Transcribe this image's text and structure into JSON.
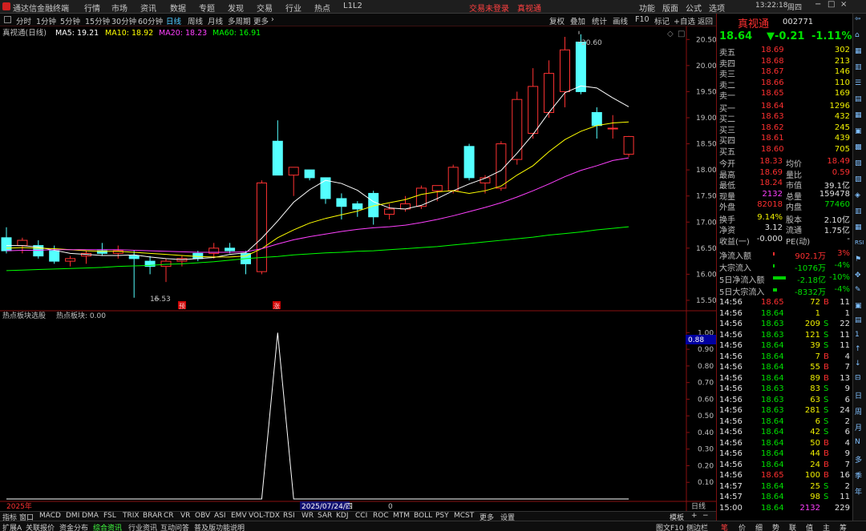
{
  "menubar": {
    "app_title": "通达信金融终端",
    "menus": [
      "行情",
      "市场",
      "资讯",
      "数据",
      "专题",
      "发现",
      "交易",
      "行业",
      "热点",
      "L1L2"
    ],
    "login_status": "交易未登录",
    "stock_name_top": "真视通",
    "right_menus": [
      "功能",
      "版面",
      "公式",
      "选项"
    ],
    "clock": "13:22:18",
    "weekday": "周四"
  },
  "periodbar": {
    "periods": [
      "分时",
      "1分钟",
      "5分钟",
      "15分钟",
      "30分钟",
      "60分钟",
      "日线",
      "周线",
      "月线",
      "多周期",
      "更多"
    ],
    "selected": "日线",
    "tools": [
      "复权",
      "叠加",
      "统计",
      "画线",
      "F10",
      "标记",
      "+自选",
      "返回"
    ]
  },
  "chart": {
    "title": "真视通(日线)",
    "ma_labels": [
      {
        "text": "MA5: 19.21",
        "color": "#ffffff"
      },
      {
        "text": "MA10: 18.92",
        "color": "#ffff00"
      },
      {
        "text": "MA20: 18.23",
        "color": "#ff40ff"
      },
      {
        "text": "MA60: 16.91",
        "color": "#00ff00"
      }
    ],
    "high_label": "20.60",
    "low_label": "15.53",
    "yu_marker": "预",
    "zhang_marker": "涨",
    "price_ticks": [
      "20.50",
      "20.00",
      "19.50",
      "19.00",
      "18.50",
      "18.00",
      "17.50",
      "17.00",
      "16.50",
      "16.00",
      "15.50"
    ],
    "indicator_title": "热点板块选股",
    "indicator_value": "热点板块: 0.00",
    "ind_ticks": [
      "1.00",
      "0.90",
      "0.80",
      "0.70",
      "0.60",
      "0.50",
      "0.40",
      "0.30",
      "0.20",
      "0.10"
    ],
    "ind_current": "0.88",
    "year_label": "2025年",
    "cursor_date": "2025/07/24/四",
    "cursor_val": "0",
    "period_tag": "日线"
  },
  "chart_data": {
    "type": "candlestick",
    "ylim": [
      15.3,
      20.75
    ],
    "candles": [
      {
        "o": 16.7,
        "h": 16.9,
        "l": 16.4,
        "c": 16.45
      },
      {
        "o": 16.55,
        "h": 16.7,
        "l": 16.4,
        "c": 16.65
      },
      {
        "o": 16.55,
        "h": 16.65,
        "l": 16.3,
        "c": 16.35
      },
      {
        "o": 16.45,
        "h": 16.55,
        "l": 16.2,
        "c": 16.25
      },
      {
        "o": 16.25,
        "h": 16.35,
        "l": 16.15,
        "c": 16.3
      },
      {
        "o": 16.35,
        "h": 16.45,
        "l": 16.2,
        "c": 16.4
      },
      {
        "o": 16.45,
        "h": 16.6,
        "l": 16.35,
        "c": 16.4
      },
      {
        "o": 16.4,
        "h": 16.55,
        "l": 16.3,
        "c": 16.45
      },
      {
        "o": 16.35,
        "h": 16.45,
        "l": 15.55,
        "c": 16.3
      },
      {
        "o": 16.25,
        "h": 16.35,
        "l": 16.0,
        "c": 16.15
      },
      {
        "o": 16.15,
        "h": 16.3,
        "l": 15.85,
        "c": 16.25
      },
      {
        "o": 16.25,
        "h": 16.35,
        "l": 16.15,
        "c": 16.3
      },
      {
        "o": 16.4,
        "h": 16.45,
        "l": 16.25,
        "c": 16.3
      },
      {
        "o": 16.4,
        "h": 16.6,
        "l": 16.3,
        "c": 16.5
      },
      {
        "o": 16.5,
        "h": 16.6,
        "l": 16.4,
        "c": 16.45
      },
      {
        "o": 16.4,
        "h": 16.45,
        "l": 16.0,
        "c": 16.2
      },
      {
        "o": 16.05,
        "h": 17.8,
        "l": 16.0,
        "c": 17.75
      },
      {
        "o": 18.55,
        "h": 18.95,
        "l": 17.9,
        "c": 17.9
      },
      {
        "o": 17.9,
        "h": 18.0,
        "l": 17.5,
        "c": 18.05
      },
      {
        "o": 18.0,
        "h": 18.0,
        "l": 17.8,
        "c": 17.85
      },
      {
        "o": 17.85,
        "h": 17.85,
        "l": 17.35,
        "c": 17.45
      },
      {
        "o": 17.45,
        "h": 17.55,
        "l": 17.05,
        "c": 17.3
      },
      {
        "o": 17.35,
        "h": 17.4,
        "l": 17.1,
        "c": 17.25
      },
      {
        "o": 17.55,
        "h": 17.6,
        "l": 16.95,
        "c": 17.1
      },
      {
        "o": 17.15,
        "h": 17.35,
        "l": 17.05,
        "c": 17.25
      },
      {
        "o": 17.25,
        "h": 17.5,
        "l": 17.2,
        "c": 17.35
      },
      {
        "o": 17.3,
        "h": 17.7,
        "l": 17.25,
        "c": 17.65
      },
      {
        "o": 17.6,
        "h": 17.7,
        "l": 17.4,
        "c": 17.7
      },
      {
        "o": 17.6,
        "h": 18.1,
        "l": 17.55,
        "c": 18.05
      },
      {
        "o": 18.45,
        "h": 18.5,
        "l": 17.8,
        "c": 17.85
      },
      {
        "o": 17.75,
        "h": 17.9,
        "l": 17.55,
        "c": 17.85
      },
      {
        "o": 17.65,
        "h": 18.55,
        "l": 17.6,
        "c": 18.5
      },
      {
        "o": 18.2,
        "h": 19.5,
        "l": 18.1,
        "c": 19.35
      },
      {
        "o": 18.7,
        "h": 19.95,
        "l": 18.6,
        "c": 19.6
      },
      {
        "o": 19.1,
        "h": 20.1,
        "l": 19.0,
        "c": 19.85
      },
      {
        "o": 19.5,
        "h": 20.55,
        "l": 19.2,
        "c": 20.3
      },
      {
        "o": 20.45,
        "h": 20.6,
        "l": 19.45,
        "c": 19.5
      },
      {
        "o": 19.1,
        "h": 19.2,
        "l": 18.6,
        "c": 18.85
      },
      {
        "o": 18.8,
        "h": 19.05,
        "l": 18.6,
        "c": 18.8
      },
      {
        "o": 18.3,
        "h": 18.65,
        "l": 18.25,
        "c": 18.64
      }
    ],
    "ma5": [
      16.55,
      16.55,
      16.52,
      16.46,
      16.4,
      16.38,
      16.36,
      16.36,
      16.37,
      16.33,
      16.3,
      16.28,
      16.3,
      16.32,
      16.38,
      16.41,
      16.69,
      17.02,
      17.38,
      17.62,
      17.8,
      17.74,
      17.61,
      17.39,
      17.27,
      17.25,
      17.32,
      17.45,
      17.6,
      17.73,
      17.84,
      17.99,
      18.32,
      18.68,
      19.1,
      19.48,
      19.61,
      19.57,
      19.38,
      19.21
    ],
    "ma10": [
      16.5,
      16.51,
      16.5,
      16.49,
      16.47,
      16.45,
      16.44,
      16.44,
      16.42,
      16.4,
      16.38,
      16.36,
      16.34,
      16.33,
      16.33,
      16.35,
      16.49,
      16.7,
      16.85,
      16.98,
      17.07,
      17.14,
      17.21,
      17.31,
      17.37,
      17.43,
      17.53,
      17.58,
      17.6,
      17.55,
      17.6,
      17.69,
      17.9,
      18.08,
      18.35,
      18.58,
      18.74,
      18.85,
      18.9,
      18.92
    ],
    "ma20": [
      16.45,
      16.46,
      16.46,
      16.47,
      16.47,
      16.47,
      16.47,
      16.47,
      16.46,
      16.45,
      16.44,
      16.43,
      16.42,
      16.42,
      16.42,
      16.43,
      16.49,
      16.58,
      16.66,
      16.72,
      16.77,
      16.82,
      16.86,
      16.89,
      16.91,
      16.94,
      16.99,
      17.05,
      17.12,
      17.2,
      17.28,
      17.37,
      17.48,
      17.6,
      17.73,
      17.87,
      17.99,
      18.08,
      18.18,
      18.23
    ],
    "ma60": [
      16.07,
      16.08,
      16.09,
      16.1,
      16.11,
      16.12,
      16.13,
      16.15,
      16.16,
      16.17,
      16.19,
      16.2,
      16.22,
      16.24,
      16.27,
      16.3,
      16.32,
      16.34,
      16.37,
      16.39,
      16.41,
      16.42,
      16.44,
      16.45,
      16.47,
      16.49,
      16.51,
      16.53,
      16.56,
      16.59,
      16.62,
      16.65,
      16.68,
      16.71,
      16.75,
      16.78,
      16.81,
      16.85,
      16.88,
      16.91
    ],
    "indicator": {
      "ylim": [
        0,
        1.05
      ],
      "values": [
        0,
        0,
        0,
        0,
        0,
        0,
        0,
        0,
        0,
        0,
        0,
        0,
        0,
        0,
        0,
        0,
        0,
        1,
        0,
        0,
        0,
        0,
        0,
        0,
        0,
        0,
        0,
        0,
        0,
        0,
        0,
        0,
        0,
        0,
        0,
        0,
        0,
        0,
        0,
        0
      ]
    }
  },
  "quote": {
    "name": "真视通",
    "code": "002771",
    "price": "18.64",
    "change": "▼-0.21",
    "pct": "-1.11%",
    "asks": [
      {
        "label": "卖五",
        "price": "18.69",
        "vol": "302"
      },
      {
        "label": "卖四",
        "price": "18.68",
        "vol": "213"
      },
      {
        "label": "卖三",
        "price": "18.67",
        "vol": "146"
      },
      {
        "label": "卖二",
        "price": "18.66",
        "vol": "110"
      },
      {
        "label": "卖一",
        "price": "18.65",
        "vol": "169"
      }
    ],
    "bids": [
      {
        "label": "买一",
        "price": "18.64",
        "vol": "1296"
      },
      {
        "label": "买二",
        "price": "18.63",
        "vol": "432"
      },
      {
        "label": "买三",
        "price": "18.62",
        "vol": "245"
      },
      {
        "label": "买四",
        "price": "18.61",
        "vol": "439"
      },
      {
        "label": "买五",
        "price": "18.60",
        "vol": "705"
      }
    ],
    "stats": [
      {
        "l1": "今开",
        "v1": "18.33",
        "c1": "red",
        "l2": "均价",
        "v2": "18.49",
        "c2": "red"
      },
      {
        "l1": "最高",
        "v1": "18.69",
        "c1": "red",
        "l2": "量比",
        "v2": "0.59",
        "c2": "red"
      },
      {
        "l1": "最低",
        "v1": "18.24",
        "c1": "red",
        "l2": "市值",
        "v2": "39.1亿",
        "c2": "wht"
      },
      {
        "l1": "现量",
        "v1": "2132",
        "c1": "mag",
        "l2": "总量",
        "v2": "159478",
        "c2": "wht"
      },
      {
        "l1": "外盘",
        "v1": "82018",
        "c1": "red",
        "l2": "内盘",
        "v2": "77460",
        "c2": "grn"
      }
    ],
    "stats2": [
      {
        "l1": "换手",
        "v1": "9.14%",
        "c1": "yel",
        "l2": "股本",
        "v2": "2.10亿",
        "c2": "wht"
      },
      {
        "l1": "净资",
        "v1": "3.12",
        "c1": "wht",
        "l2": "流通",
        "v2": "1.75亿",
        "c2": "wht"
      },
      {
        "l1": "收益(一)",
        "v1": "-0.000",
        "c1": "wht",
        "l2": "PE(动)",
        "v2": "-",
        "c2": "wht"
      }
    ],
    "flows": [
      {
        "label": "净流入额",
        "val": "902.1万",
        "pct": "3%",
        "color": "red",
        "bar": 0.05
      },
      {
        "label": "大宗流入",
        "val": "-1076万",
        "pct": "-4%",
        "color": "grn",
        "bar": 0.05
      },
      {
        "label": "5日净流入额",
        "val": "-2.18亿",
        "pct": "-10%",
        "color": "grn",
        "bar": 0.9
      },
      {
        "label": "5日大宗流入",
        "val": "-8332万",
        "pct": "-4%",
        "color": "grn",
        "bar": 0.3
      }
    ],
    "ticks": [
      {
        "t": "14:56",
        "p": "18.65",
        "v": "72",
        "d": "B",
        "n": "11"
      },
      {
        "t": "14:56",
        "p": "18.64",
        "v": "1",
        "d": "",
        "n": "1"
      },
      {
        "t": "14:56",
        "p": "18.63",
        "v": "209",
        "d": "S",
        "n": "22"
      },
      {
        "t": "14:56",
        "p": "18.63",
        "v": "121",
        "d": "S",
        "n": "11"
      },
      {
        "t": "14:56",
        "p": "18.64",
        "v": "39",
        "d": "S",
        "n": "11"
      },
      {
        "t": "14:56",
        "p": "18.64",
        "v": "7",
        "d": "B",
        "n": "4"
      },
      {
        "t": "14:56",
        "p": "18.64",
        "v": "55",
        "d": "B",
        "n": "7"
      },
      {
        "t": "14:56",
        "p": "18.64",
        "v": "89",
        "d": "B",
        "n": "13"
      },
      {
        "t": "14:56",
        "p": "18.63",
        "v": "83",
        "d": "S",
        "n": "9"
      },
      {
        "t": "14:56",
        "p": "18.63",
        "v": "63",
        "d": "S",
        "n": "6"
      },
      {
        "t": "14:56",
        "p": "18.63",
        "v": "281",
        "d": "S",
        "n": "24"
      },
      {
        "t": "14:56",
        "p": "18.64",
        "v": "6",
        "d": "S",
        "n": "2"
      },
      {
        "t": "14:56",
        "p": "18.64",
        "v": "42",
        "d": "S",
        "n": "6"
      },
      {
        "t": "14:56",
        "p": "18.64",
        "v": "50",
        "d": "B",
        "n": "4"
      },
      {
        "t": "14:56",
        "p": "18.64",
        "v": "44",
        "d": "B",
        "n": "9"
      },
      {
        "t": "14:56",
        "p": "18.64",
        "v": "24",
        "d": "B",
        "n": "7"
      },
      {
        "t": "14:56",
        "p": "18.65",
        "v": "100",
        "d": "B",
        "n": "16"
      },
      {
        "t": "14:57",
        "p": "18.64",
        "v": "25",
        "d": "S",
        "n": "2"
      },
      {
        "t": "14:57",
        "p": "18.64",
        "v": "98",
        "d": "S",
        "n": "11"
      },
      {
        "t": "15:00",
        "p": "18.64",
        "v": "2132",
        "d": "",
        "n": "229"
      }
    ]
  },
  "sidebar_labels": [
    "日",
    "周",
    "月",
    "N",
    "多",
    "季",
    "年"
  ],
  "indbar": {
    "label": "指标",
    "items": [
      "窗口",
      "MACD",
      "DMI",
      "DMA",
      "FSL",
      "TRIX",
      "BRAR",
      "CR",
      "VR",
      "OBV",
      "ASI",
      "EMV",
      "VOL-TDX",
      "RSI",
      "WR",
      "SAR",
      "KDJ",
      "CCI",
      "ROC",
      "MTM",
      "BOLL",
      "PSY",
      "MCST",
      "更多",
      "设置"
    ],
    "right": [
      "模板",
      "+",
      "−"
    ]
  },
  "statusbar": {
    "items": [
      "扩展A",
      "关联报价",
      "资金分布",
      "综合资讯",
      "行业资讯",
      "互动问答",
      "普及版功能说明"
    ],
    "right": "图文F10",
    "right2": "侧边栏",
    "tabs": [
      "笔",
      "价",
      "细",
      "势",
      "联",
      "值",
      "主",
      "筹"
    ]
  }
}
